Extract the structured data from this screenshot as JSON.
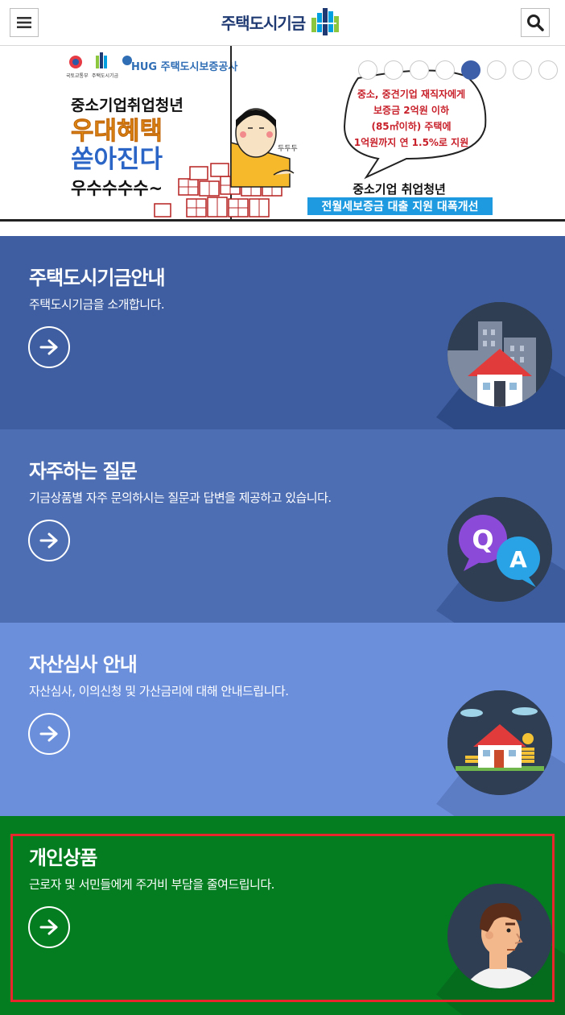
{
  "header": {
    "logo_text": "주택도시기금",
    "menu_icon": "hamburger-menu-icon",
    "search_icon": "search-icon"
  },
  "banner": {
    "agency_logos": [
      "국토교통부",
      "주택도시기금",
      "HUG 주택도시보증공사"
    ],
    "headline_1": "중소기업취업청년",
    "headline_2": "우대혜택",
    "headline_3": "쏟아진다",
    "headline_4": "우수수수수~",
    "sfx": "두두두",
    "bubble_line_1": "중소, 중견기업 재직자에게",
    "bubble_line_2": "보증금 2억원 이하",
    "bubble_line_3": "(85㎡이하) 주택에",
    "bubble_line_4": "1억원까지 연 1.5%로 지원",
    "subtitle": "중소기업 취업청년",
    "subtitle_highlight": "전월세보증금 대출 지원 대폭개선",
    "slide_count": 8,
    "active_slide": 5
  },
  "sections": [
    {
      "title": "주택도시기금안내",
      "desc": "주택도시기금을 소개합니다.",
      "icon": "city-house-icon"
    },
    {
      "title": "자주하는 질문",
      "desc": "기금상품별 자주 문의하시는 질문과 답변을 제공하고 있습니다.",
      "icon": "qa-bubbles-icon"
    },
    {
      "title": "자산심사 안내",
      "desc": "자산심사, 이의신청 및 가산금리에 대해 안내드립니다.",
      "icon": "house-coins-icon"
    },
    {
      "title": "개인상품",
      "desc": "근로자 및 서민들에게 주거비 부담을 줄여드립니다.",
      "icon": "man-avatar-icon"
    }
  ],
  "colors": {
    "section_1": "#3e5ea1",
    "section_2": "#4e6eb4",
    "section_3": "#6c8fdc",
    "section_4": "#037d20",
    "highlight": "#e8262b"
  }
}
